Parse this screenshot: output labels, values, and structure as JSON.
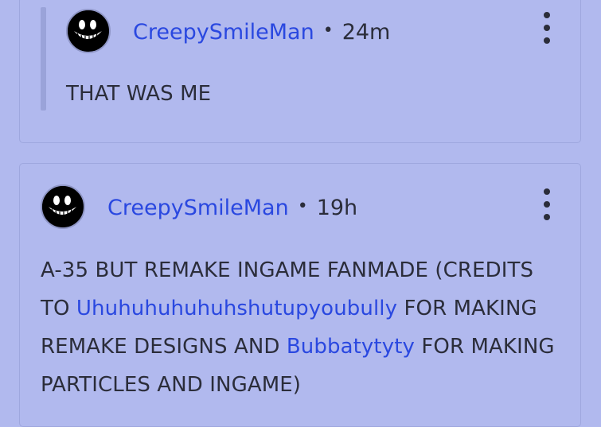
{
  "reply": {
    "username": "CreepySmileMan",
    "separator": "•",
    "time": "24m",
    "text": "THAT WAS ME"
  },
  "comment": {
    "username": "CreepySmileMan",
    "separator": "•",
    "time": "19h",
    "text_1": "A-35 BUT REMAKE INGAME FANMADE (CREDITS",
    "text_2a": "TO ",
    "mention_1": "Uhuhuhuhuhuhshutupyoubully",
    "text_2b": " FOR MAKING",
    "text_3a": "REMAKE DESIGNS AND ",
    "mention_2": "Bubbatytyty",
    "text_3b": " FOR MAKING",
    "text_4": "PARTICLES AND INGAME)"
  },
  "colors": {
    "background": "#b1b9ee",
    "link": "#2a48e0",
    "text": "#2b2d3a"
  },
  "icons": {
    "more": "more-vertical-icon",
    "avatar": "creepy-smile-avatar"
  }
}
